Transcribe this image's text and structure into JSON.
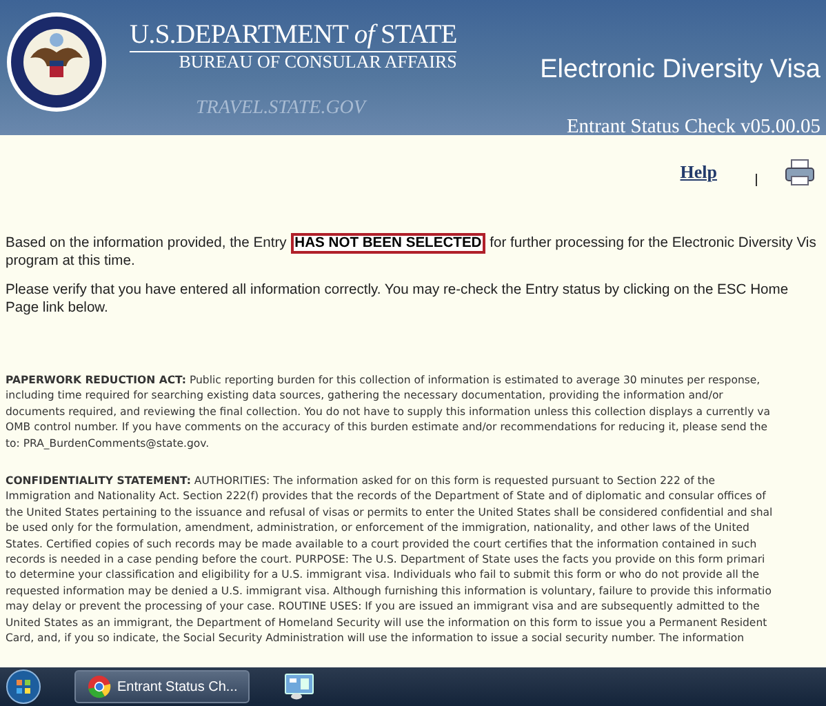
{
  "header": {
    "department": "U.S.DEPARTMENT",
    "department_of": "of",
    "department_state": "STATE",
    "bureau": "BUREAU OF CONSULAR AFFAIRS",
    "site": "TRAVEL.STATE.GOV",
    "app_title": "Electronic Diversity Visa",
    "app_subtitle": "Entrant Status Check v05.00.05"
  },
  "toolbar": {
    "help_link": "Help"
  },
  "result": {
    "before": "Based on the information provided, the Entry",
    "status": "HAS NOT BEEN SELECTED",
    "after": "for further processing for the Electronic Diversity Vis",
    "line_2": "program at this time."
  },
  "instructions": [
    "Please verify that you have entered all information correctly. You may re-check the Entry status by clicking on the ESC Home",
    "Page link below."
  ],
  "notices": [
    {
      "lines": [
        "**PAPERWORK REDUCTION ACT:** Public reporting burden for this collection of information is estimated to average 30 minutes per response,",
        "including time required for searching existing data sources, gathering the necessary documentation, providing the information and/or",
        "documents required, and reviewing the final collection. You do not have to supply this information unless this collection displays a currently va",
        "OMB control number. If you have comments on the accuracy of this burden estimate and/or recommendations for reducing it, please send the",
        "to: PRA_BurdenComments@state.gov."
      ]
    },
    {
      "lines": [
        "**CONFIDENTIALITY STATEMENT:**  AUTHORITIES: The information asked for on this form is requested pursuant to Section 222 of the",
        "Immigration and Nationality Act. Section 222(f) provides that the records of the Department of State and of diplomatic and consular offices of",
        "the United States pertaining to the issuance and refusal of visas or permits to enter the United States shall be considered confidential and shal",
        "be used only for the formulation, amendment, administration, or enforcement of the immigration, nationality, and other laws of the United",
        "States. Certified copies of such records may be made available to a court provided the court certifies that the information contained in such",
        "records is needed in a case pending before the court. PURPOSE: The U.S. Department of State uses the facts you provide on this form primari",
        "to determine your classification and eligibility for a U.S. immigrant visa. Individuals who fail to submit this form or who do not provide all the",
        "requested information may be denied a U.S. immigrant visa. Although furnishing this information is voluntary, failure to provide this informatio",
        "may delay or prevent the processing of your case. ROUTINE USES: If you are issued an immigrant visa and are subsequently admitted to the",
        "United States as an immigrant, the Department of Homeland Security will use the information on this form to issue you a Permanent Resident",
        "Card, and, if you so indicate, the Social Security Administration will use the information to issue a social security number. The information"
      ]
    }
  ],
  "taskbar": {
    "tasks": [
      {
        "kind": "browser",
        "label": "Entrant Status Ch...",
        "selected": true
      },
      {
        "kind": "panel",
        "selected": false
      }
    ]
  }
}
